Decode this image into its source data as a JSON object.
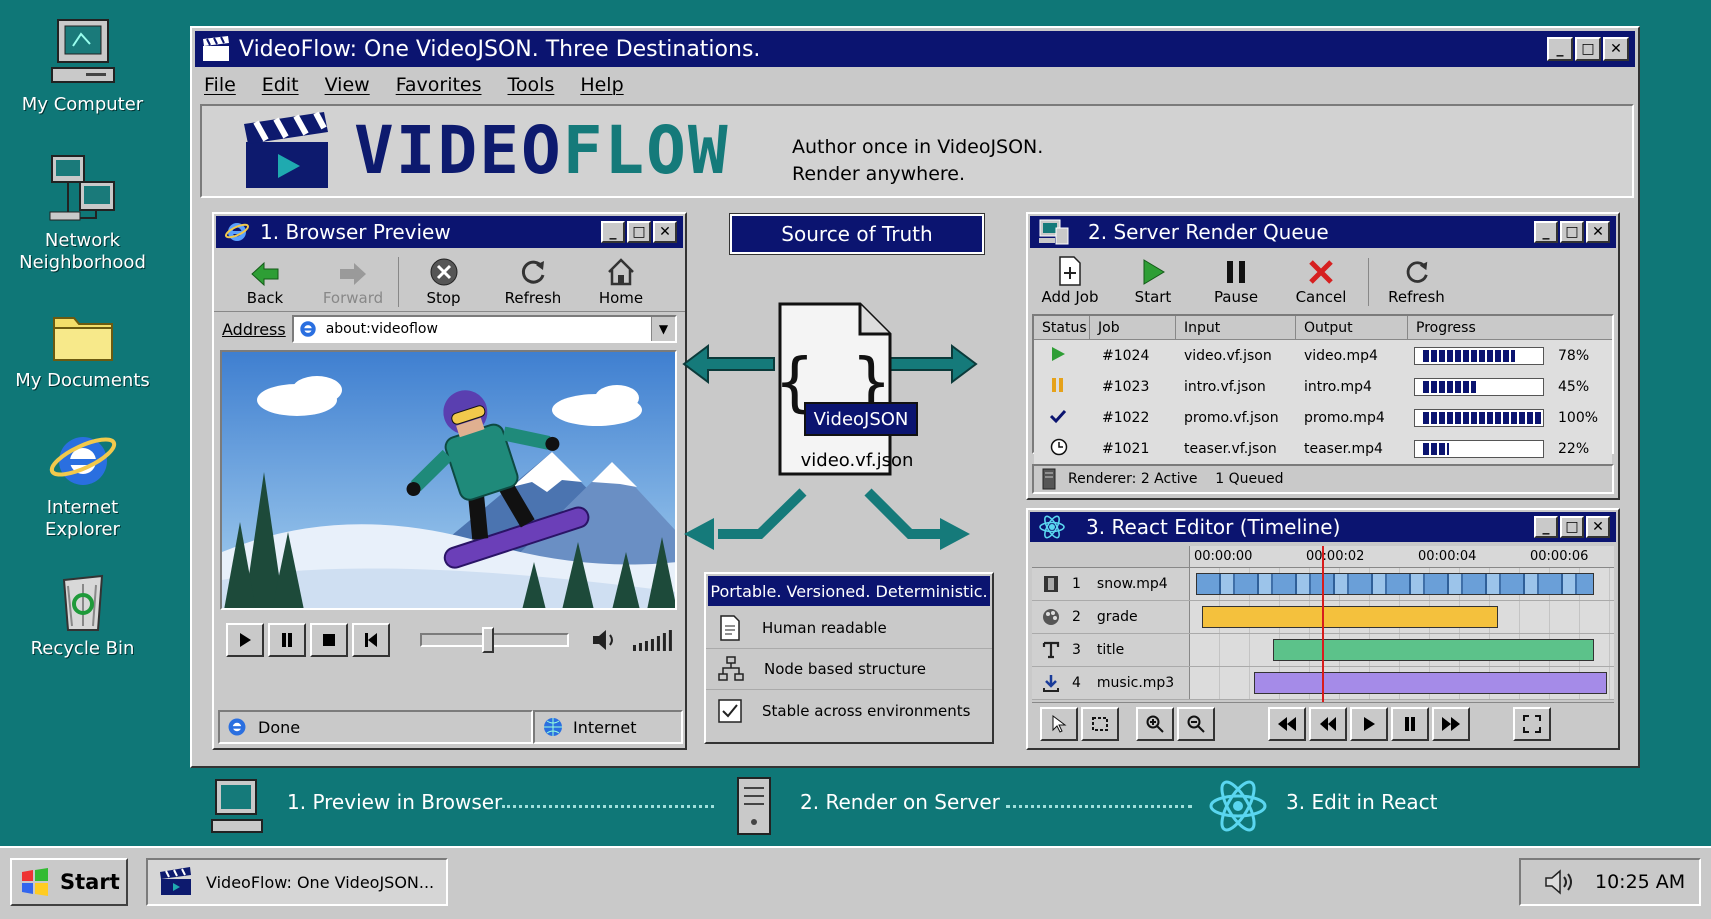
{
  "desktop": {
    "icons": [
      {
        "label": "My Computer",
        "icon": "computer-icon"
      },
      {
        "label": "Network Neighborhood",
        "icon": "network-icon"
      },
      {
        "label": "My Documents",
        "icon": "folder-icon"
      },
      {
        "label": "Internet Explorer",
        "icon": "ie-icon"
      },
      {
        "label": "Recycle Bin",
        "icon": "recycle-bin-icon"
      }
    ]
  },
  "window": {
    "title": "VideoFlow: One VideoJSON. Three Destinations.",
    "menu": [
      "File",
      "Edit",
      "View",
      "Favorites",
      "Tools",
      "Help"
    ],
    "logo_part1": "VIDEO",
    "logo_part2": "FLOW",
    "tagline1": "Author once in VideoJSON.",
    "tagline2": "Render anywhere."
  },
  "browser": {
    "title": "1. Browser Preview",
    "tools": [
      "Back",
      "Forward",
      "Stop",
      "Refresh",
      "Home"
    ],
    "address_label": "Address",
    "address": "about:videoflow",
    "status_left": "Done",
    "status_right": "Internet",
    "volume_level": 0.45
  },
  "source": {
    "title": "Source of Truth",
    "badge": "VideoJSON",
    "filename": "video.vf.json",
    "features_title": "Portable. Versioned. Deterministic.",
    "features": [
      "Human readable",
      "Node based structure",
      "Stable across environments"
    ]
  },
  "queue": {
    "title": "2. Server Render Queue",
    "tools": [
      "Add Job",
      "Start",
      "Pause",
      "Cancel",
      "Refresh"
    ],
    "columns": [
      "Status",
      "Job",
      "Input",
      "Output",
      "Progress"
    ],
    "rows": [
      {
        "status": "playing",
        "job": "#1024",
        "input": "video.vf.json",
        "output": "video.mp4",
        "progress": 78,
        "label": "78%"
      },
      {
        "status": "paused",
        "job": "#1023",
        "input": "intro.vf.json",
        "output": "intro.mp4",
        "progress": 45,
        "label": "45%"
      },
      {
        "status": "done",
        "job": "#1022",
        "input": "promo.vf.json",
        "output": "promo.mp4",
        "progress": 100,
        "label": "100%"
      },
      {
        "status": "waiting",
        "job": "#1021",
        "input": "teaser.vf.json",
        "output": "teaser.mp4",
        "progress": 22,
        "label": "22%"
      }
    ],
    "status_bar": "Renderer: 2 Active    1 Queued"
  },
  "editor": {
    "title": "3. React Editor (Timeline)",
    "ticks": [
      "00:00:00",
      "00:00:02",
      "00:00:04",
      "00:00:06"
    ],
    "tracks": [
      {
        "num": "1",
        "name": "snow.mp4",
        "start": 0.0,
        "end": 3.1,
        "color": "#4a7fb8"
      },
      {
        "num": "2",
        "name": "grade",
        "start": 0.05,
        "end": 2.35,
        "color": "#f4c13d"
      },
      {
        "num": "3",
        "name": "title",
        "start": 0.6,
        "end": 3.1,
        "color": "#5cc28a"
      },
      {
        "num": "4",
        "name": "music.mp3",
        "start": 0.45,
        "end": 3.2,
        "color": "#a58be8"
      }
    ],
    "playhead": 0.98
  },
  "steps": [
    "1. Preview in Browser",
    "2. Render on Server",
    "3. Edit in React"
  ],
  "taskbar": {
    "start": "Start",
    "task": "VideoFlow: One VideoJSON...",
    "time": "10:25 AM"
  },
  "colors": {
    "desktop": "#0f7777",
    "titlebar": "#0b1470",
    "accent": "#157a7a"
  }
}
